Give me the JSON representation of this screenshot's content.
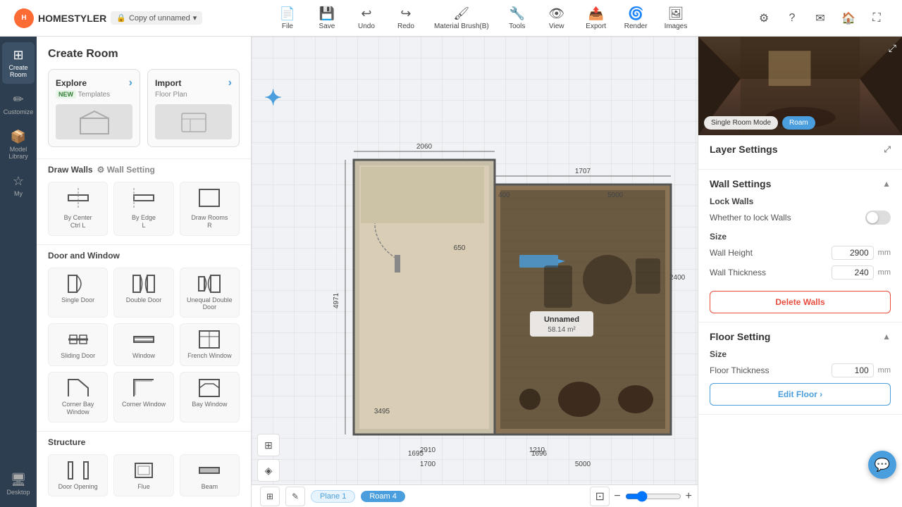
{
  "brand": {
    "logo_text": "H",
    "name": "HOMESTYLER",
    "file_name": "Copy of unnamed"
  },
  "toolbar": {
    "tools": [
      {
        "id": "file",
        "label": "File",
        "icon": "📄"
      },
      {
        "id": "save",
        "label": "Save",
        "icon": "💾"
      },
      {
        "id": "undo",
        "label": "Undo",
        "icon": "↩"
      },
      {
        "id": "redo",
        "label": "Redo",
        "icon": "↪"
      },
      {
        "id": "material-brush",
        "label": "Material Brush(B)",
        "icon": "🖌"
      },
      {
        "id": "tools",
        "label": "Tools",
        "icon": "🔧"
      },
      {
        "id": "view",
        "label": "View",
        "icon": "👁"
      },
      {
        "id": "export",
        "label": "Export",
        "icon": "📤"
      },
      {
        "id": "render",
        "label": "Render",
        "icon": "🌀"
      },
      {
        "id": "images",
        "label": "Images",
        "icon": "🖼"
      }
    ],
    "right_icons": [
      "⚙",
      "?",
      "✉",
      "🏠",
      "⛶"
    ]
  },
  "left_nav": {
    "items": [
      {
        "id": "create-room",
        "label": "Create Room",
        "icon": "⊞",
        "active": true
      },
      {
        "id": "customize",
        "label": "Customize",
        "icon": "✏"
      },
      {
        "id": "model-library",
        "label": "Model Library",
        "icon": "📦"
      },
      {
        "id": "my",
        "label": "My",
        "icon": "👤"
      },
      {
        "id": "desktop",
        "label": "Desktop",
        "icon": "🖥"
      }
    ]
  },
  "left_panel": {
    "title": "Create Room",
    "cards": [
      {
        "id": "explore",
        "title": "Explore",
        "subtitle": "Templates",
        "has_new": true,
        "icon": "🏠"
      },
      {
        "id": "import",
        "title": "Import",
        "subtitle": "Floor Plan",
        "has_new": false,
        "icon": "📋"
      }
    ],
    "draw_walls": {
      "title": "Draw Walls",
      "items": [
        {
          "id": "by-center",
          "label": "By Center\nCtrl L",
          "icon": "⊞"
        },
        {
          "id": "by-edge",
          "label": "By Edge\nL",
          "icon": "⊟"
        },
        {
          "id": "draw-rooms",
          "label": "Draw Rooms\nR",
          "icon": "⬜"
        }
      ]
    },
    "door_window": {
      "title": "Door and Window",
      "items": [
        {
          "id": "single-door",
          "label": "Single Door",
          "icon": "🚪"
        },
        {
          "id": "double-door",
          "label": "Double Door",
          "icon": "🚪"
        },
        {
          "id": "unequal-double-door",
          "label": "Unequal Double Door",
          "icon": "🚪"
        },
        {
          "id": "sliding-door",
          "label": "Sliding Door",
          "icon": "⊟"
        },
        {
          "id": "window",
          "label": "Window",
          "icon": "⊟"
        },
        {
          "id": "french-window",
          "label": "French Window",
          "icon": "⊟"
        },
        {
          "id": "corner-bay-window",
          "label": "Corner Bay Window",
          "icon": "⊟"
        },
        {
          "id": "corner-window",
          "label": "Corner Window",
          "icon": "⊟"
        },
        {
          "id": "bay-window",
          "label": "Bay Window",
          "icon": "⊟"
        }
      ]
    },
    "structure": {
      "title": "Structure",
      "items": [
        {
          "id": "door-opening",
          "label": "Door Opening",
          "icon": "⊓"
        },
        {
          "id": "flue",
          "label": "Flue",
          "icon": "▣"
        },
        {
          "id": "beam",
          "label": "Beam",
          "icon": "▬"
        }
      ]
    }
  },
  "right_panel": {
    "preview": {
      "mode_label": "Single Room Mode",
      "roam_label": "Roam"
    },
    "layer_settings": {
      "title": "Layer Settings"
    },
    "wall_settings": {
      "title": "Wall Settings",
      "lock_walls_label": "Lock Walls",
      "whether_lock_label": "Whether to lock Walls",
      "size_label": "Size",
      "wall_height_label": "Wall Height",
      "wall_height_value": "2900",
      "wall_height_unit": "mm",
      "wall_thickness_label": "Wall Thickness",
      "wall_thickness_value": "240",
      "wall_thickness_unit": "mm",
      "delete_btn_label": "Delete Walls"
    },
    "floor_setting": {
      "title": "Floor Setting",
      "size_label": "Size",
      "floor_thickness_label": "Floor Thickness",
      "floor_thickness_value": "100",
      "floor_thickness_unit": "mm",
      "edit_btn_label": "Edit Floor ›"
    }
  },
  "canvas": {
    "plane_tab": "Plane 1",
    "room_tab": "Roam 4",
    "room_label": "Unnamed",
    "room_area": "58.14 m²",
    "dimensions": {
      "top1": "2060",
      "top2": "1707",
      "left1": "4971",
      "mid1": "650",
      "top3": "400",
      "top4": "5000",
      "right1": "2400",
      "btm1": "2910",
      "btm2": "1210",
      "btm3": "3495",
      "btm4": "1695",
      "btm5": "1696",
      "btm6": "1700",
      "btm7": "5000"
    }
  }
}
